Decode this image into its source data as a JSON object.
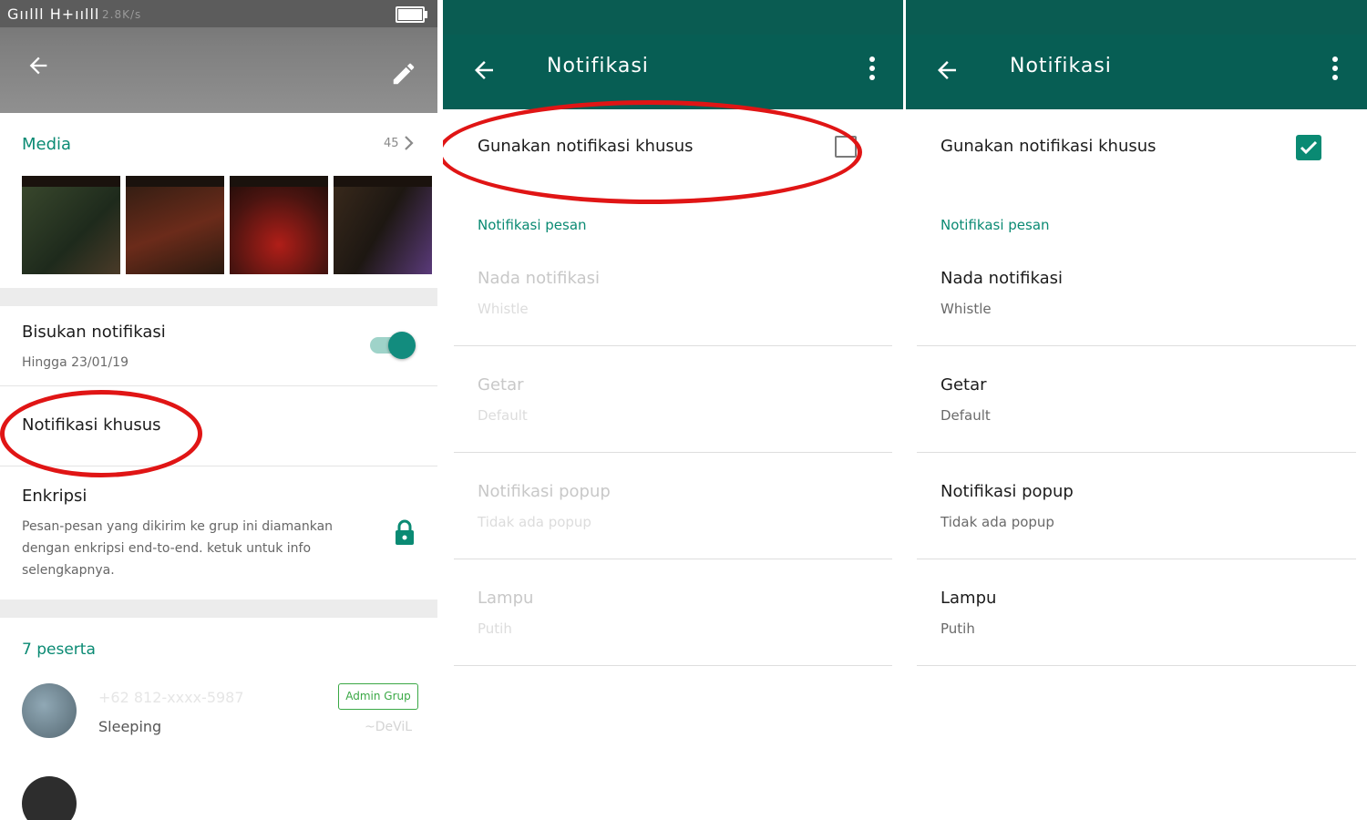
{
  "panel1": {
    "status_left": "Gıılll H+ıılll",
    "header_faint": "2.8K/s",
    "media": {
      "label": "Media",
      "count": "45"
    },
    "mute": {
      "title": "Bisukan notifikasi",
      "subtitle": "Hingga 23/01/19",
      "enabled": true
    },
    "custom_notif": {
      "title": "Notifikasi khusus"
    },
    "encryption": {
      "title": "Enkripsi",
      "description": "Pesan-pesan yang dikirim ke grup ini diamankan dengan enkripsi end-to-end. ketuk untuk info selengkapnya."
    },
    "participants": {
      "label": "7 peserta",
      "members": [
        {
          "name": "+62 812-xxxx-5987",
          "status": "Sleeping",
          "badge": "Admin Grup",
          "nickname": "~DeViL"
        }
      ]
    }
  },
  "panel2": {
    "title": "Notifikasi",
    "use_custom_label": "Gunakan notifikasi khusus",
    "use_custom_checked": false,
    "section": "Notifikasi pesan",
    "settings": [
      {
        "title": "Nada notifikasi",
        "value": "Whistle"
      },
      {
        "title": "Getar",
        "value": "Default"
      },
      {
        "title": "Notifikasi popup",
        "value": "Tidak ada popup"
      },
      {
        "title": "Lampu",
        "value": "Putih"
      }
    ]
  },
  "panel3": {
    "title": "Notifikasi",
    "use_custom_label": "Gunakan notifikasi khusus",
    "use_custom_checked": true,
    "section": "Notifikasi pesan",
    "settings": [
      {
        "title": "Nada notifikasi",
        "value": "Whistle"
      },
      {
        "title": "Getar",
        "value": "Default"
      },
      {
        "title": "Notifikasi popup",
        "value": "Tidak ada popup"
      },
      {
        "title": "Lampu",
        "value": "Putih"
      }
    ]
  },
  "colors": {
    "teal_dark": "#075e54",
    "teal_accent": "#0a8a73",
    "highlight_red": "#e01515",
    "admin_green": "#3aa845"
  }
}
